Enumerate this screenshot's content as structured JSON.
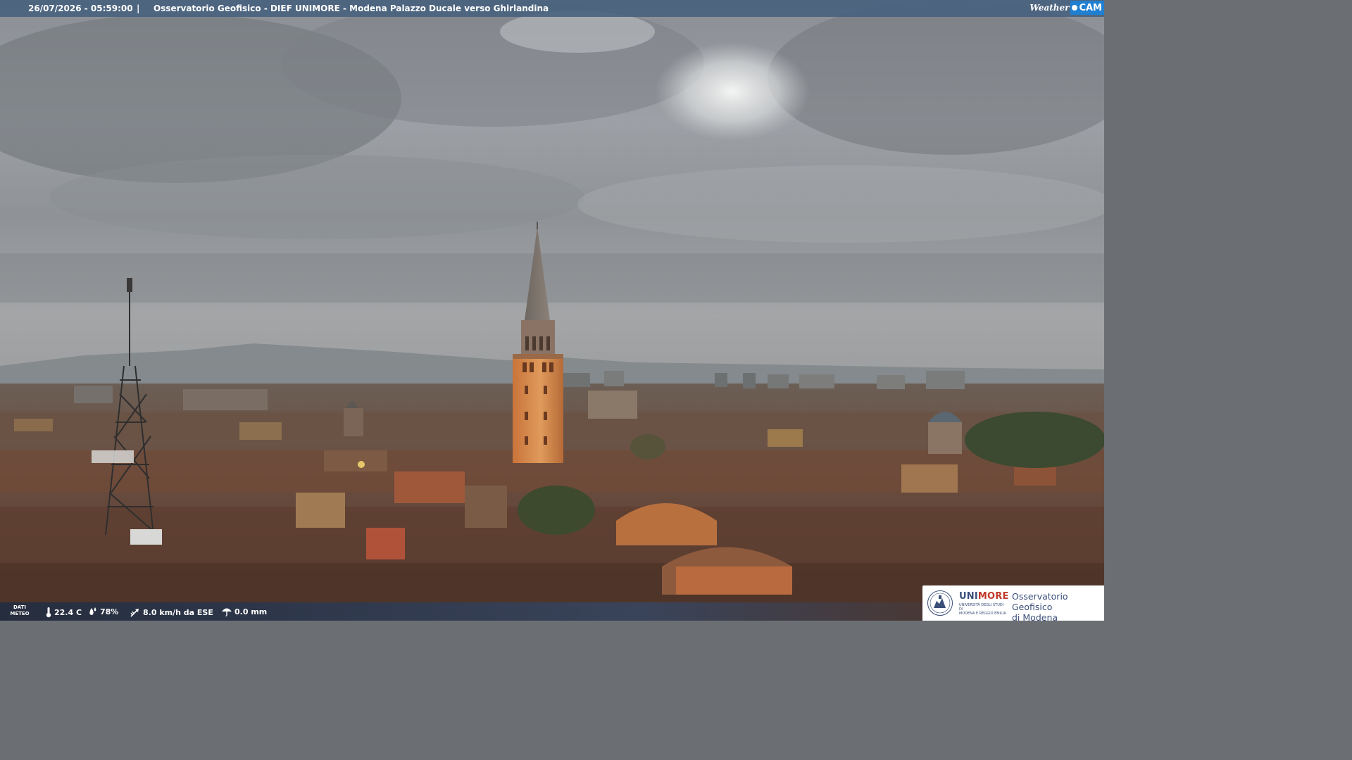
{
  "header": {
    "timestamp": "26/07/2026 - 05:59:00",
    "separator": "|",
    "title": "Osservatorio Geofisico - DIEF UNIMORE - Modena Palazzo Ducale verso Ghirlandina"
  },
  "brand": {
    "weather": "Weather",
    "cam": "CAM"
  },
  "weather_bar": {
    "label_line1": "DATI",
    "label_line2": "METEO",
    "temperature": "22.4 C",
    "humidity": "78%",
    "wind": "8.0 km/h da ESE",
    "rain": "0.0 mm"
  },
  "institution": {
    "name_part1": "UNI",
    "name_part2": "MORE",
    "university_line1": "UNIVERSITÀ DEGLI STUDI DI",
    "university_line2": "MODENA E REGGIO EMILIA",
    "observatory_line1": "Osservatorio Geofisico",
    "observatory_line2": "di Modena"
  },
  "colors": {
    "topbar": "#46607d",
    "accent_blue": "#1f7fd1",
    "unimore_blue": "#3a4e7a",
    "unimore_red": "#c0392b",
    "tower_lit": "#d8894c"
  }
}
